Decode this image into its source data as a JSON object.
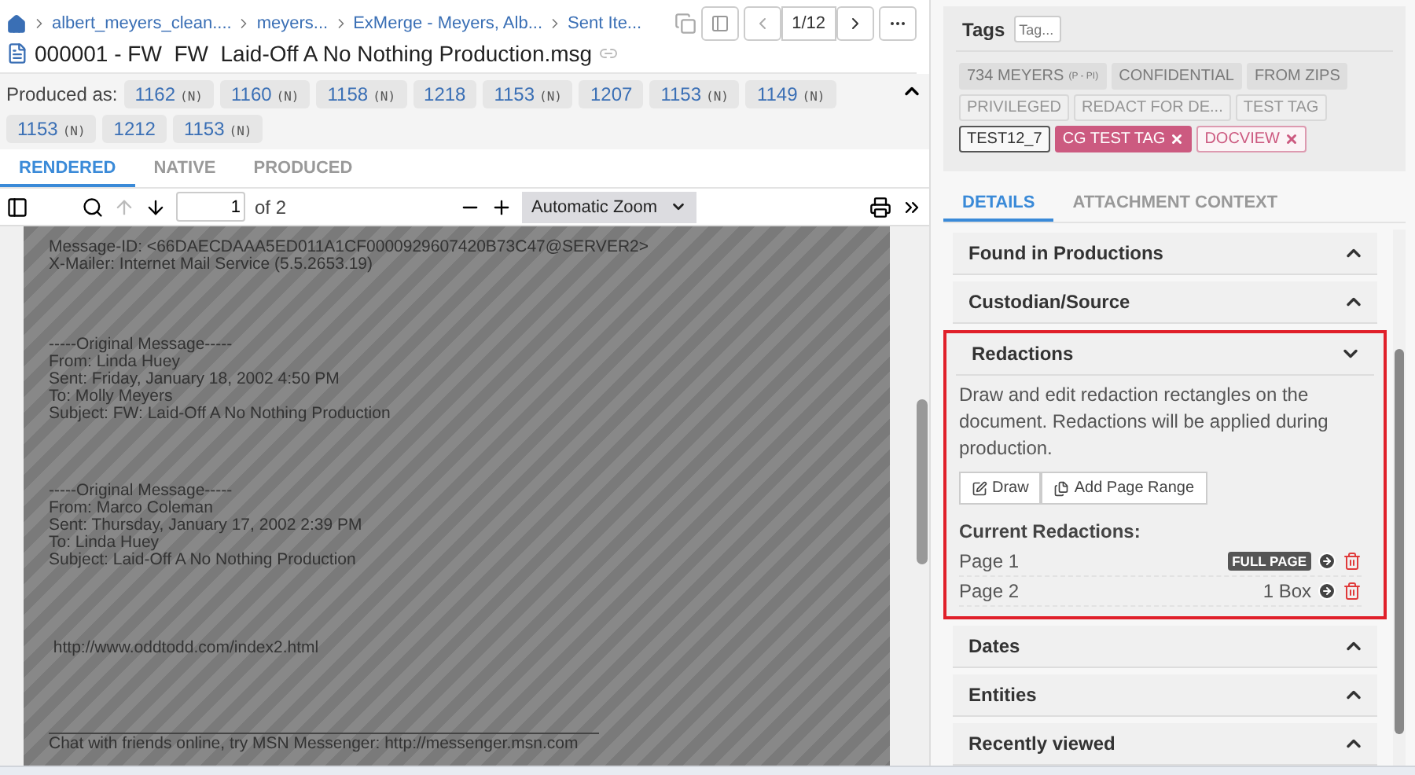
{
  "breadcrumbs": [
    "albert_meyers_clean....",
    "meyers...",
    "ExMerge - Meyers, Alb...",
    "Sent Ite..."
  ],
  "pager": "1/12",
  "document_title": "000001 - FW  FW  Laid-Off A No Nothing Production.msg",
  "produced_as": {
    "label": "Produced as:",
    "expanded": true,
    "chips": [
      {
        "number": "1162",
        "suffix": "(N)"
      },
      {
        "number": "1160",
        "suffix": "(N)"
      },
      {
        "number": "1158",
        "suffix": "(N)"
      },
      {
        "number": "1218"
      },
      {
        "number": "1153",
        "suffix": "(N)"
      },
      {
        "number": "1207"
      },
      {
        "number": "1153",
        "suffix": "(N)"
      },
      {
        "number": "1149",
        "suffix": "(N)"
      },
      {
        "number": "1153",
        "suffix": "(N)"
      },
      {
        "number": "1212"
      },
      {
        "number": "1153",
        "suffix": "(N)"
      }
    ]
  },
  "viewer_tabs": [
    {
      "label": "RENDERED",
      "selected": true
    },
    {
      "label": "NATIVE",
      "selected": false
    },
    {
      "label": "PRODUCED",
      "selected": false
    }
  ],
  "pdf_toolbar": {
    "page": "1",
    "total": "of 2",
    "zoom": "Automatic Zoom"
  },
  "document_blocks": [
    [
      "Message-ID: <66DAECDAAA5ED011A1CF0000929607420B73C47@SERVER2>",
      "X-Mailer: Internet Mail Service (5.5.2653.19)"
    ],
    [
      "-----Original Message-----",
      "From: Linda Huey",
      "Sent: Friday, January 18, 2002 4:50 PM",
      "To: Molly Meyers",
      "Subject: FW: Laid-Off A No Nothing Production"
    ],
    [
      "-----Original Message-----",
      "From: Marco Coleman",
      "Sent: Thursday, January 17, 2002 2:39 PM",
      "To: Linda Huey",
      "Subject: Laid-Off A No Nothing Production"
    ],
    [
      " http://www.oddtodd.com/index2.html"
    ],
    [
      "Chat with friends online, try MSN Messenger: http://messenger.msn.com"
    ]
  ],
  "tags": {
    "label": "Tags",
    "placeholder": "Tag...",
    "chips": [
      {
        "label": "734 MEYERS",
        "suffix": "(P - PI)",
        "kind": "filled",
        "removable": false
      },
      {
        "label": "CONFIDENTIAL",
        "kind": "filled",
        "removable": false
      },
      {
        "label": "FROM ZIPS",
        "kind": "filled",
        "removable": false
      },
      {
        "label": "PRIVILEGED",
        "kind": "faded",
        "removable": false
      },
      {
        "label": "REDACT FOR DE...",
        "kind": "faded",
        "removable": false
      },
      {
        "label": "TEST TAG",
        "kind": "faded",
        "removable": false
      },
      {
        "label": "TEST12_7",
        "kind": "outlined",
        "removable": false
      },
      {
        "label": "CG TEST TAG",
        "kind": "pink",
        "removable": true
      },
      {
        "label": "DOCVIEW",
        "kind": "pink_outline",
        "removable": true
      }
    ]
  },
  "detail_tabs": [
    {
      "label": "DETAILS",
      "selected": true
    },
    {
      "label": "ATTACHMENT CONTEXT",
      "selected": false
    }
  ],
  "sections": [
    {
      "title": "Found in Productions",
      "expanded": false
    },
    {
      "title": "Custodian/Source",
      "expanded": false
    },
    {
      "title": "Redactions",
      "expanded": true,
      "highlighted": true,
      "description": "Draw and edit redaction rectangles on the document. Redactions will be applied during production.",
      "buttons": [
        {
          "label": "Draw",
          "kind": "draw"
        },
        {
          "label": "Add Page Range",
          "kind": "range"
        }
      ],
      "list_title": "Current Redactions:",
      "redactions": [
        {
          "page": "Page 1",
          "kind": "badge",
          "info": "FULL PAGE"
        },
        {
          "page": "Page 2",
          "kind": "text",
          "info": "1 Box"
        }
      ]
    },
    {
      "title": "Dates",
      "expanded": false
    },
    {
      "title": "Entities",
      "expanded": false
    },
    {
      "title": "Recently viewed",
      "expanded": false
    }
  ]
}
